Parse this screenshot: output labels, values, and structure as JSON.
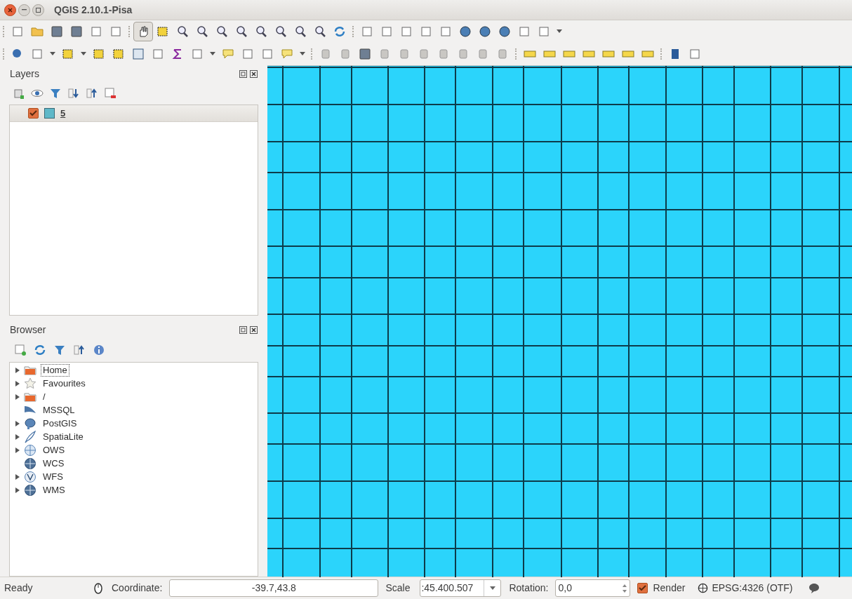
{
  "window": {
    "title": "QGIS 2.10.1-Pisa"
  },
  "layers_panel": {
    "title": "Layers",
    "layers": [
      {
        "name": "5",
        "checked": true,
        "color": "#5fb8c8"
      }
    ]
  },
  "browser_panel": {
    "title": "Browser",
    "items": [
      {
        "label": "Home",
        "kind": "folder",
        "expandable": true,
        "selected": true
      },
      {
        "label": "Favourites",
        "kind": "star",
        "expandable": true,
        "selected": false
      },
      {
        "label": "/",
        "kind": "folder",
        "expandable": true,
        "selected": false
      },
      {
        "label": "MSSQL",
        "kind": "mssql",
        "expandable": false,
        "selected": false
      },
      {
        "label": "PostGIS",
        "kind": "postgis",
        "expandable": true,
        "selected": false
      },
      {
        "label": "SpatiaLite",
        "kind": "feather",
        "expandable": true,
        "selected": false
      },
      {
        "label": "OWS",
        "kind": "globe",
        "expandable": true,
        "selected": false
      },
      {
        "label": "WCS",
        "kind": "globe-dark",
        "expandable": false,
        "selected": false
      },
      {
        "label": "WFS",
        "kind": "globe-v",
        "expandable": true,
        "selected": false
      },
      {
        "label": "WMS",
        "kind": "globe-dark",
        "expandable": true,
        "selected": false
      }
    ]
  },
  "status_bar": {
    "message": "Ready",
    "coordinate_label": "Coordinate:",
    "coordinate": "-39.7,43.8",
    "scale_label": "Scale",
    "scale": ":45.400.507",
    "rotation_label": "Rotation:",
    "rotation": "0,0",
    "render_label": "Render",
    "render_checked": true,
    "crs": "EPSG:4326 (OTF)"
  }
}
